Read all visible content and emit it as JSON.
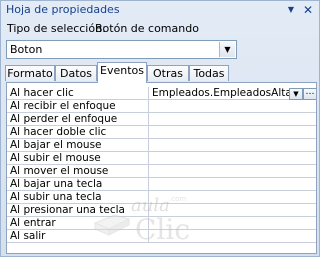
{
  "window": {
    "title": "Hoja de propiedades",
    "dropdown_icon": "dropdown-arrow",
    "close_icon": "close-x"
  },
  "selection": {
    "label": "Tipo de selección:",
    "type": "Botón de comando"
  },
  "object_selector": {
    "value": "Boton"
  },
  "tabs": [
    {
      "label": "Formato",
      "active": false
    },
    {
      "label": "Datos",
      "active": false
    },
    {
      "label": "Eventos",
      "active": true
    },
    {
      "label": "Otras",
      "active": false
    },
    {
      "label": "Todas",
      "active": false
    }
  ],
  "properties": [
    {
      "name": "Al hacer clic",
      "value": "Empleados.EmpleadosAlta"
    },
    {
      "name": "Al recibir el enfoque",
      "value": ""
    },
    {
      "name": "Al perder el enfoque",
      "value": ""
    },
    {
      "name": "Al hacer doble clic",
      "value": ""
    },
    {
      "name": "Al bajar el mouse",
      "value": ""
    },
    {
      "name": "Al subir el mouse",
      "value": ""
    },
    {
      "name": "Al mover el mouse",
      "value": ""
    },
    {
      "name": "Al bajar una tecla",
      "value": ""
    },
    {
      "name": "Al subir una tecla",
      "value": ""
    },
    {
      "name": "Al presionar una tecla",
      "value": ""
    },
    {
      "name": "Al entrar",
      "value": ""
    },
    {
      "name": "Al salir",
      "value": ""
    }
  ],
  "watermark": {
    "brand": "aula",
    "domain": ".com",
    "word": "Clic"
  },
  "colors": {
    "pane_background": "#d5e0ee",
    "title_text": "#15428b",
    "grid_line": "#c8cfda"
  }
}
